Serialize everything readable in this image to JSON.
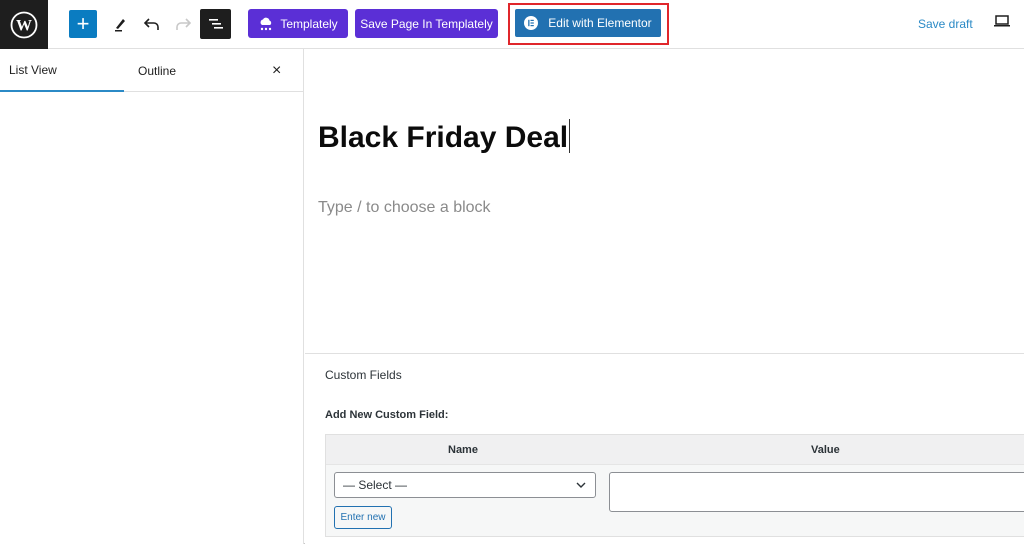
{
  "toolbar": {
    "logo": "wordpress-logo",
    "add_block": "+",
    "templately_label": "Templately",
    "save_templately_label": "Save Page In Templately",
    "elementor_label": "Edit with Elementor",
    "save_draft_label": "Save draft",
    "colors": {
      "add_block": "#0a7cc1",
      "templately": "#5b2fd6",
      "elementor": "#2271b1",
      "highlight": "#e0262b",
      "link": "#2b8ac6"
    }
  },
  "sidebar": {
    "tabs": [
      {
        "label": "List View",
        "active": true
      },
      {
        "label": "Outline",
        "active": false
      }
    ],
    "close_label": "×"
  },
  "editor": {
    "title": "Black Friday Deal",
    "placeholder": "Type / to choose a block"
  },
  "custom_fields": {
    "title": "Custom Fields",
    "add_new_label": "Add New Custom Field:",
    "columns": [
      "Name",
      "Value"
    ],
    "select_value": "— Select —",
    "enter_new_label": "Enter new",
    "value_text": ""
  }
}
